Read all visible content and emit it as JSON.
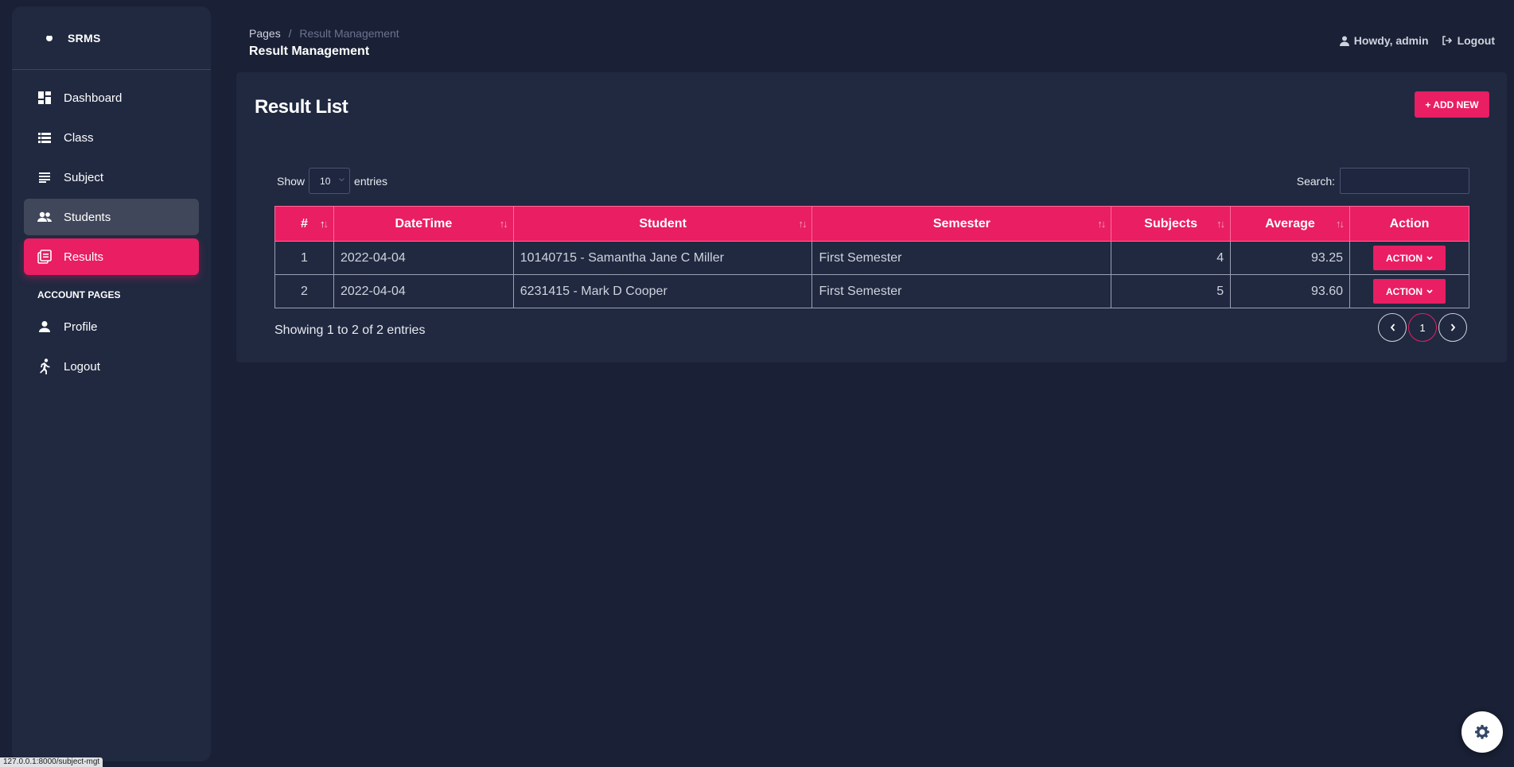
{
  "sidebar": {
    "brand": "SRMS",
    "items": [
      {
        "label": "Dashboard",
        "icon": "dashboard-icon"
      },
      {
        "label": "Class",
        "icon": "list-icon"
      },
      {
        "label": "Subject",
        "icon": "notes-icon"
      },
      {
        "label": "Students",
        "icon": "people-icon"
      },
      {
        "label": "Results",
        "icon": "results-icon"
      }
    ],
    "section_title": "ACCOUNT PAGES",
    "account_items": [
      {
        "label": "Profile",
        "icon": "person-icon"
      },
      {
        "label": "Logout",
        "icon": "running-icon"
      }
    ]
  },
  "header": {
    "breadcrumb_root": "Pages",
    "breadcrumb_sep": "/",
    "breadcrumb_current": "Result Management",
    "title": "Result Management",
    "user_greeting": "Howdy, admin",
    "logout_label": "Logout"
  },
  "card": {
    "title": "Result List",
    "add_button": "+ ADD NEW",
    "show_label": "Show",
    "entries_value": "10",
    "entries_label": "entries",
    "search_label": "Search:",
    "search_value": "",
    "columns": [
      "#",
      "DateTime",
      "Student",
      "Semester",
      "Subjects",
      "Average",
      "Action"
    ],
    "rows": [
      {
        "num": "1",
        "datetime": "2022-04-04",
        "student": "10140715 - Samantha Jane C Miller",
        "semester": "First Semester",
        "subjects": "4",
        "average": "93.25",
        "action": "ACTION"
      },
      {
        "num": "2",
        "datetime": "2022-04-04",
        "student": "6231415 - Mark D Cooper",
        "semester": "First Semester",
        "subjects": "5",
        "average": "93.60",
        "action": "ACTION"
      }
    ],
    "info": "Showing 1 to 2 of 2 entries",
    "current_page": "1"
  },
  "statusbar": "127.0.0.1:8000/subject-mgt",
  "colors": {
    "accent": "#e91e63",
    "background": "#1a2035",
    "panel": "#202940"
  }
}
